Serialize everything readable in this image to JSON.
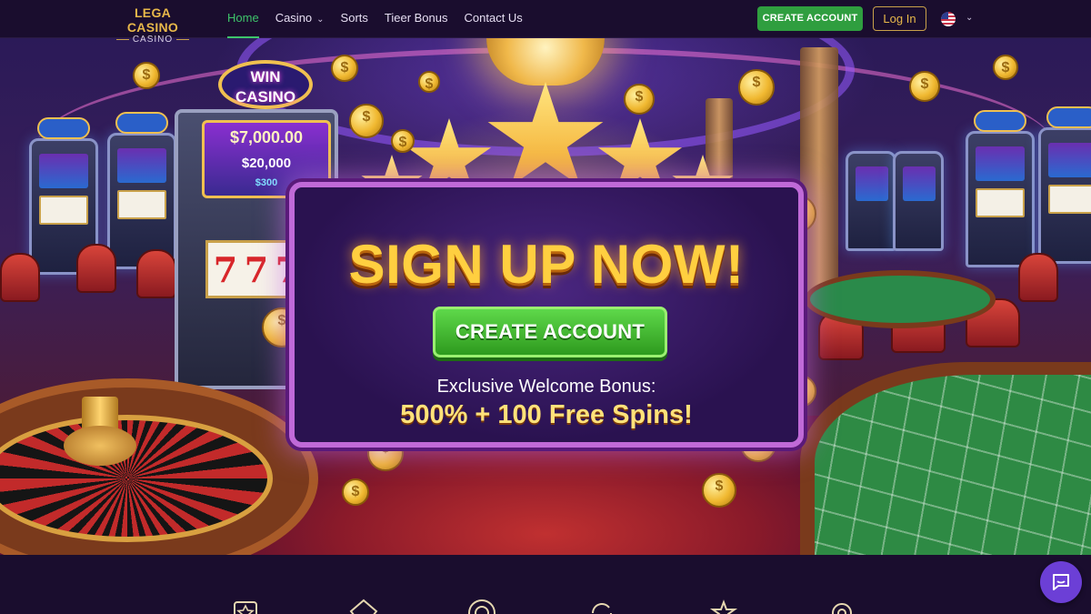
{
  "header": {
    "logo": {
      "main": "LEGA CASINO",
      "sub": "CASINO"
    },
    "nav": [
      {
        "label": "Home",
        "active": true
      },
      {
        "label": "Casino",
        "dropdown": true
      },
      {
        "label": "Sorts"
      },
      {
        "label": "Tieer Bonus"
      },
      {
        "label": "Contact Us"
      }
    ],
    "create_account_label": "CREATE ACCOUNT",
    "login_label": "Log In",
    "language_icon": "us-flag-icon"
  },
  "hero": {
    "sign": "WIN CASINO",
    "jackpots": [
      "$7,000.00",
      "$20,000",
      "$300"
    ],
    "panel": {
      "title": "SIGN UP NOW!",
      "button_label": "CREATE ACCOUNT",
      "subtitle": "Exclusive Welcome Bonus:",
      "offer": "500% + 100 Free Spins!"
    }
  },
  "features": {
    "icons": [
      "star-badge-icon",
      "diamond-icon",
      "chip-icon",
      "refresh-icon",
      "trophy-icon",
      "gear-badge-icon"
    ]
  },
  "chat": {
    "icon": "chat-icon"
  },
  "colors": {
    "accent_green": "#2f9e3f",
    "gold": "#e8b84a",
    "panel_border": "#c06ad8",
    "header_bg": "#1a0d2e",
    "chat_purple": "#6c3fd6"
  }
}
